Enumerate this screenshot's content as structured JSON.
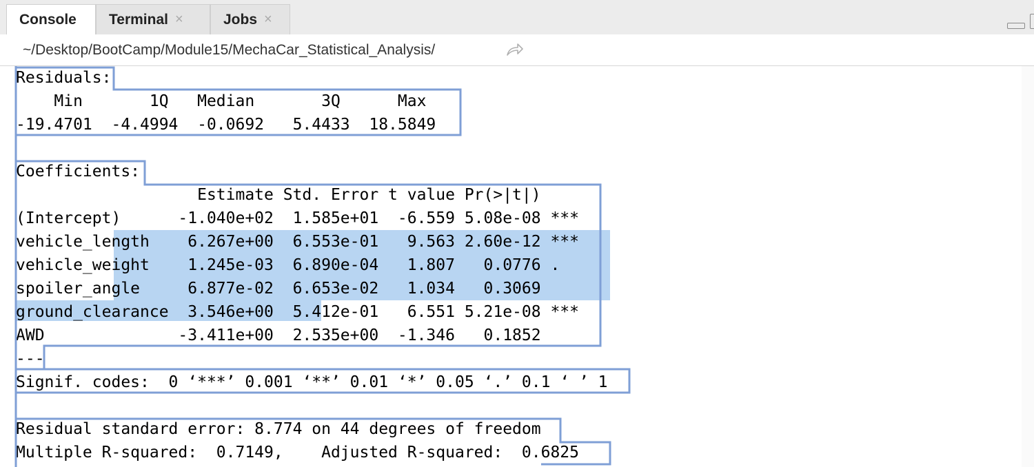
{
  "tabs": [
    {
      "label": "Console",
      "closable": false
    },
    {
      "label": "Terminal",
      "closable": true,
      "close_glyph": "×"
    },
    {
      "label": "Jobs",
      "closable": true,
      "close_glyph": "×"
    }
  ],
  "path": {
    "text": "~/Desktop/BootCamp/Module15/MechaCar_Statistical_Analysis/",
    "arrow_icon": "go-to-directory-icon"
  },
  "console": {
    "lines": [
      "Residuals:",
      "    Min       1Q   Median       3Q      Max",
      "-19.4701  -4.4994  -0.0692   5.4433  18.5849",
      "",
      "Coefficients:",
      "                   Estimate Std. Error t value Pr(>|t|)",
      "(Intercept)      -1.040e+02  1.585e+01  -6.559 5.08e-08 ***",
      "vehicle_length    6.267e+00  6.553e-01   9.563 2.60e-12 ***",
      "vehicle_weight    1.245e-03  6.890e-04   1.807   0.0776 .",
      "spoiler_angle     6.877e-02  6.653e-02   1.034   0.3069",
      "ground_clearance  3.546e+00  5.412e-01   6.551 5.21e-08 ***",
      "AWD              -3.411e+00  2.535e+00  -1.346   0.1852",
      "---",
      "Signif. codes:  0 ‘***’ 0.001 ‘**’ 0.01 ‘*’ 0.05 ‘.’ 0.1 ‘ ’ 1",
      "",
      "Residual standard error: 8.774 on 44 degrees of freedom",
      "Multiple R-squared:  0.7149,    Adjusted R-squared:  0.6825"
    ]
  },
  "colors": {
    "selection_highlight": "#b8d5f2",
    "selection_outline": "#7f9fd6"
  }
}
